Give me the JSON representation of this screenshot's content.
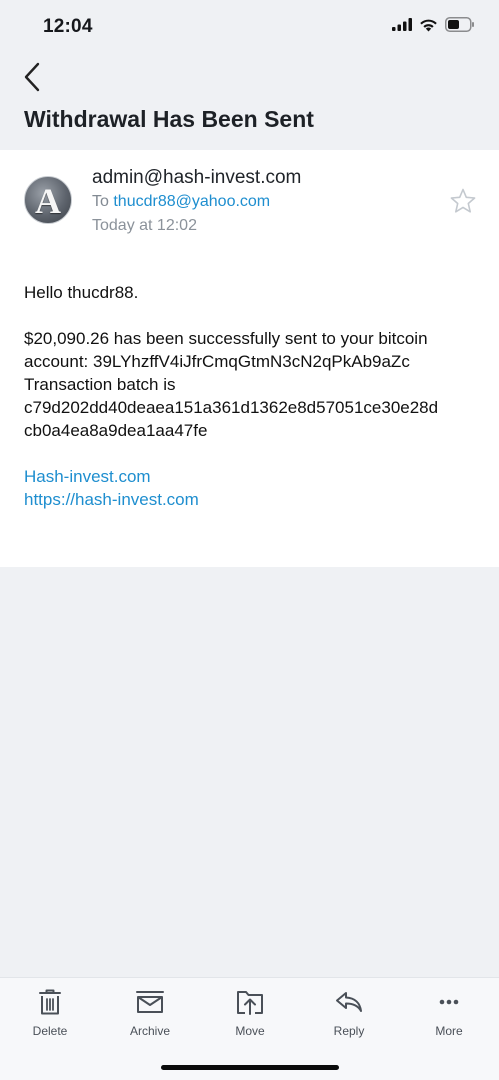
{
  "status_bar": {
    "time": "12:04",
    "icons": [
      "cellular-signal-icon",
      "wifi-icon",
      "battery-icon"
    ]
  },
  "header": {
    "back_icon": "chevron-left-icon",
    "title": "Withdrawal Has Been Sent"
  },
  "email": {
    "avatar_letter": "A",
    "sender": "admin@hash-invest.com",
    "to_label": "To",
    "to_address": "thucdr88@yahoo.com",
    "date": "Today at 12:02",
    "star_icon": "star-outline-icon",
    "greeting": "Hello thucdr88.",
    "message_lines": [
      "$20,090.26 has been successfully sent to your bitcoin",
      "account: 39LYhzffV4iJfrCmqGtmN3cN2qPkAb9aZc",
      "Transaction batch is",
      "c79d202dd40deaea151a361d1362e8d57051ce30e28d",
      "cb0a4ea8a9dea1aa47fe"
    ],
    "links": [
      "Hash-invest.com",
      "https://hash-invest.com"
    ]
  },
  "toolbar": {
    "items": [
      {
        "label": "Delete",
        "icon": "trash-icon"
      },
      {
        "label": "Archive",
        "icon": "archive-icon"
      },
      {
        "label": "Move",
        "icon": "move-folder-icon"
      },
      {
        "label": "Reply",
        "icon": "reply-icon"
      },
      {
        "label": "More",
        "icon": "more-dots-icon"
      }
    ]
  },
  "colors": {
    "background": "#eff1f4",
    "card": "#ffffff",
    "link": "#1e8ecf",
    "toolbar_icon": "#4a5058"
  }
}
